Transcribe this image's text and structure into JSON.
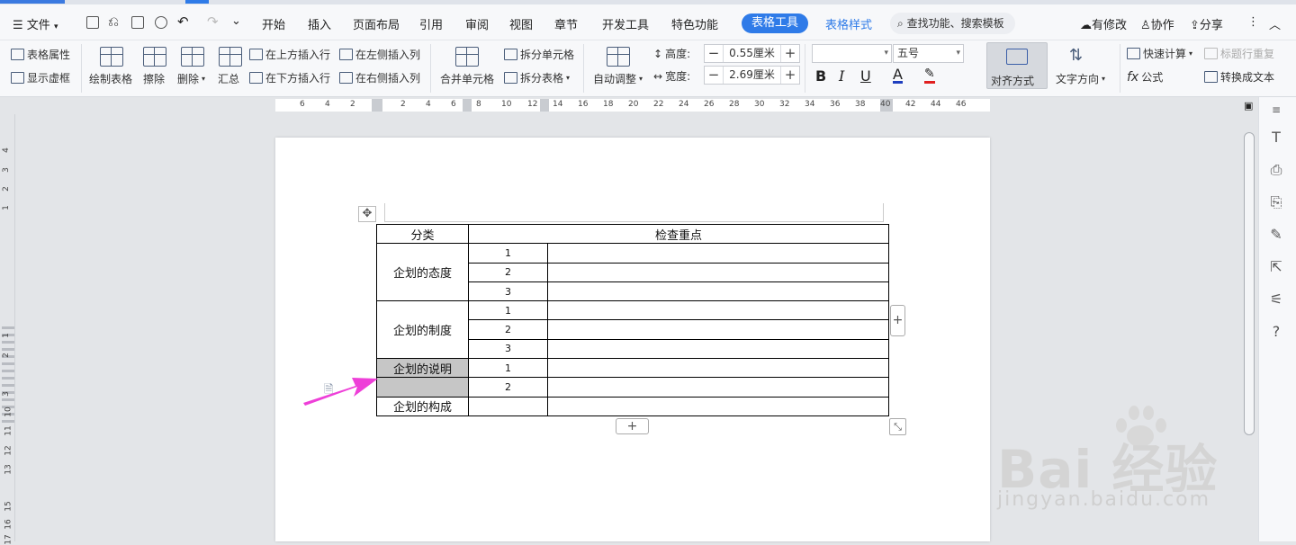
{
  "menu": {
    "file": "文件",
    "items": [
      "开始",
      "插入",
      "页面布局",
      "引用",
      "审阅",
      "视图",
      "章节",
      "开发工具",
      "特色功能"
    ],
    "table_tools": "表格工具",
    "table_style": "表格样式",
    "search": "查找功能、搜索模板",
    "modified": "有修改",
    "collab": "协作",
    "share": "分享"
  },
  "ribbon": {
    "table_props": "表格属性",
    "show_grid": "显示虚框",
    "draw_table": "绘制表格",
    "erase": "擦除",
    "delete": "删除",
    "summary": "汇总",
    "insert_above": "在上方插入行",
    "insert_below": "在下方插入行",
    "insert_left": "在左侧插入列",
    "insert_right": "在右侧插入列",
    "merge_cells": "合并单元格",
    "split_cells": "拆分单元格",
    "split_table": "拆分表格",
    "auto_adjust": "自动调整",
    "height_label": "高度:",
    "height_value": "0.55厘米",
    "width_label": "宽度:",
    "width_value": "2.69厘米",
    "font_name": "",
    "font_size": "五号",
    "bold": "B",
    "italic": "I",
    "underline": "U",
    "font_color": "A",
    "align_mode": "对齐方式",
    "text_direction": "文字方向",
    "quick_calc": "快速计算",
    "formula": "公式",
    "title_repeat": "标题行重复",
    "to_text": "转换成文本"
  },
  "ruler": {
    "h": [
      "6",
      "4",
      "2",
      "2",
      "4",
      "6",
      "8",
      "10",
      "12",
      "14",
      "16",
      "18",
      "20",
      "22",
      "24",
      "26",
      "28",
      "30",
      "32",
      "34",
      "36",
      "38",
      "40",
      "42",
      "44",
      "46"
    ],
    "v": [
      "4",
      "3",
      "2",
      "1",
      "1",
      "2",
      "3",
      "10",
      "11",
      "12",
      "13",
      "15",
      "16",
      "17"
    ]
  },
  "table": {
    "header": [
      "分类",
      "检查重点"
    ],
    "groups": [
      {
        "category": "企划的态度",
        "rows": [
          "1",
          "2",
          "3"
        ]
      },
      {
        "category": "企划的制度",
        "rows": [
          "1",
          "2",
          "3"
        ]
      },
      {
        "category": "企划的说明",
        "rows": [
          "1",
          "2"
        ]
      },
      {
        "category": "企划的构成",
        "rows": [
          ""
        ]
      }
    ]
  },
  "watermark": {
    "line1": "Bai  经验",
    "line2": "jingyan.baidu.com"
  },
  "colors": {
    "accent": "#2f7be8",
    "arrow": "#ee3fd8",
    "selected_cell": "#c6c6c6"
  }
}
